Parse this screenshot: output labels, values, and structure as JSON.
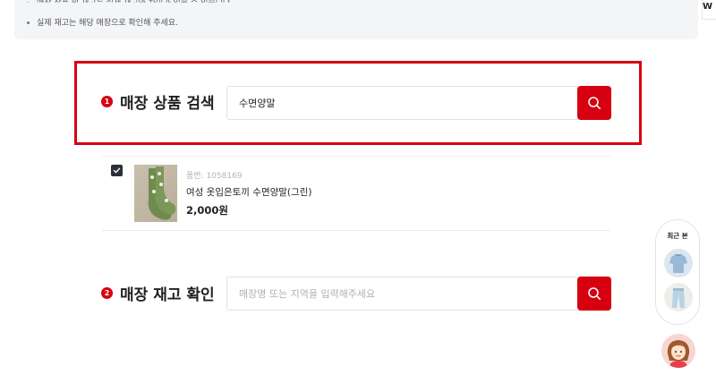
{
  "notice": {
    "line1": "매장 상품 및 재고는 실제 재고와 차이가 있을 수 있습니다.",
    "line2": "실제 재고는 해당 매장으로 확인해 주세요."
  },
  "corner_glyph": "W",
  "product_search": {
    "badge": "1",
    "title": "매장 상품 검색",
    "input_value": "수면양말"
  },
  "product": {
    "checked": true,
    "code": "품번: 1058169",
    "name": "여성 옷입은토끼 수면양말(그린)",
    "price": "2,000원"
  },
  "stock_check": {
    "badge": "2",
    "title": "매장 재고 확인",
    "placeholder": "매장명 또는 지역을 입력해주세요"
  },
  "recent_viewed": {
    "label": "최근 본"
  },
  "colors": {
    "accent": "#d60011",
    "checkbox": "#2b2f3a",
    "notice_bg": "#f4f5f7"
  },
  "icons": [
    "search-icon",
    "check-icon",
    "chatbot-avatar-icon"
  ]
}
